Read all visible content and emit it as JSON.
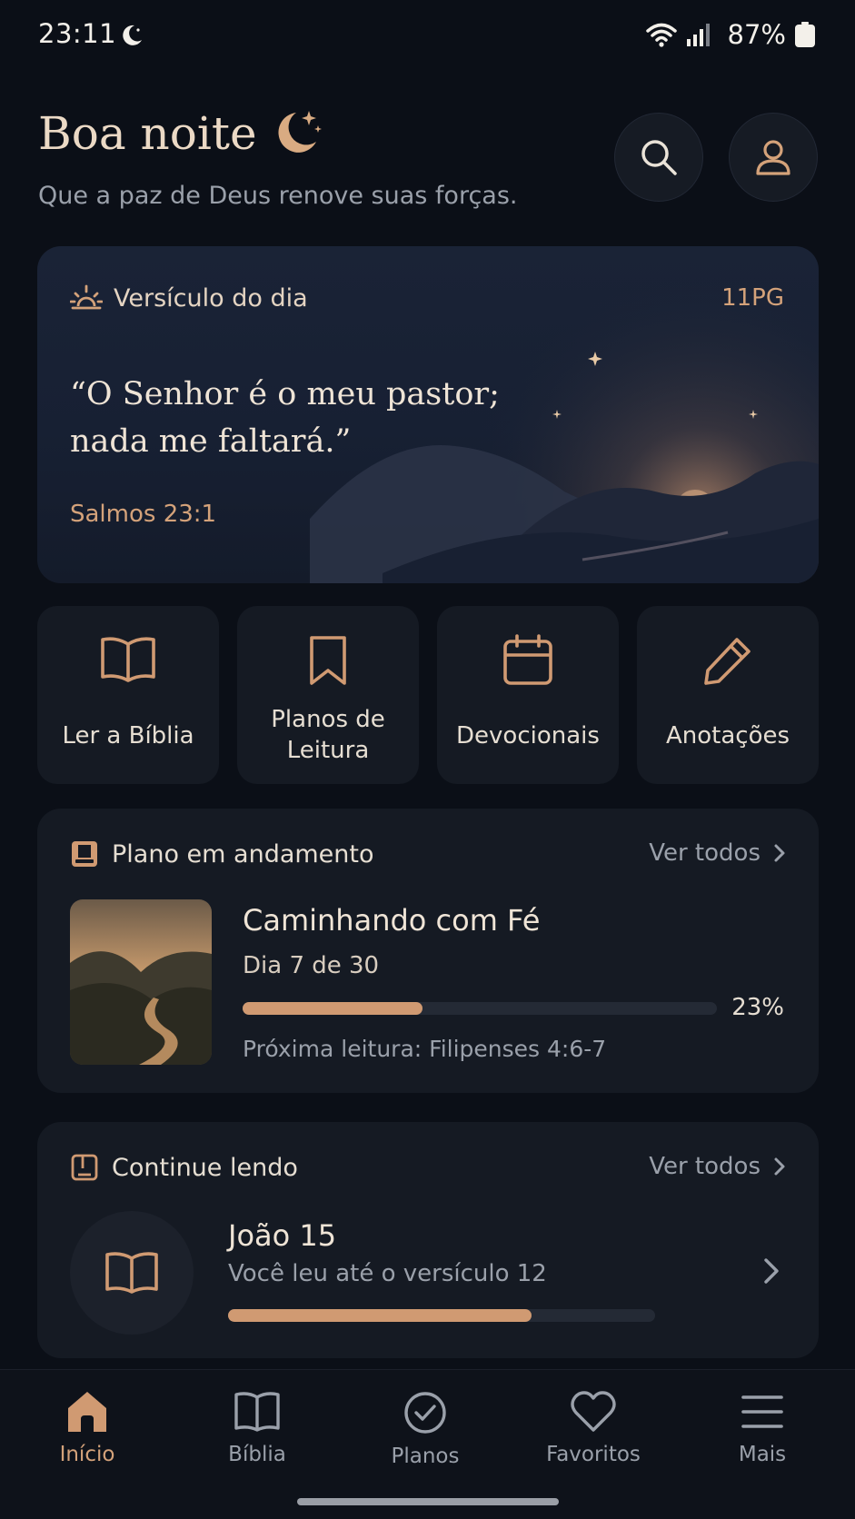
{
  "status_bar": {
    "time": "23:11",
    "battery": "87%",
    "icons": [
      "moon-icon",
      "wifi-icon",
      "signal-icon",
      "battery-icon"
    ]
  },
  "header": {
    "greeting": "Boa noite",
    "subtitle": "Que a paz de Deus renove suas forças.",
    "icons": [
      "crescent-moon-stars-icon",
      "search-icon",
      "profile-icon"
    ]
  },
  "verse_card": {
    "label": "Versículo do dia",
    "code": "11PG",
    "text": "“O Senhor é o meu pastor; nada me faltará.”",
    "reference": "Salmos 23:1",
    "icon": "sunrise-icon"
  },
  "quick_actions": [
    {
      "label": "Ler a Bíblia",
      "icon": "book-open-icon"
    },
    {
      "label": "Planos de Leitura",
      "icon": "bookmark-icon"
    },
    {
      "label": "Devocionais",
      "icon": "calendar-icon"
    },
    {
      "label": "Anotações",
      "icon": "pencil-icon"
    }
  ],
  "plan_card": {
    "title": "Plano em andamento",
    "see_all": "Ver todos",
    "plan_name": "Caminhando com Fé",
    "day": "Dia 7 de 30",
    "progress_label": "23%",
    "progress_fraction": 0.38,
    "next_reading": "Próxima leitura: Filipenses 4:6-7"
  },
  "continue_card": {
    "title": "Continue lendo",
    "see_all": "Ver todos",
    "chapter": "João 15",
    "subtitle": "Você leu até o versículo 12",
    "progress_fraction": 0.71
  },
  "bottom_nav": [
    {
      "label": "Início",
      "icon": "home-icon",
      "active": true
    },
    {
      "label": "Bíblia",
      "icon": "book-icon",
      "active": false
    },
    {
      "label": "Planos",
      "icon": "check-circle-icon",
      "active": false
    },
    {
      "label": "Favoritos",
      "icon": "heart-icon",
      "active": false
    },
    {
      "label": "Mais",
      "icon": "menu-icon",
      "active": false
    }
  ],
  "colors": {
    "background": "#0b0f17",
    "card": "#151a23",
    "accent": "#d4a27a",
    "progress": "#d09a72"
  }
}
